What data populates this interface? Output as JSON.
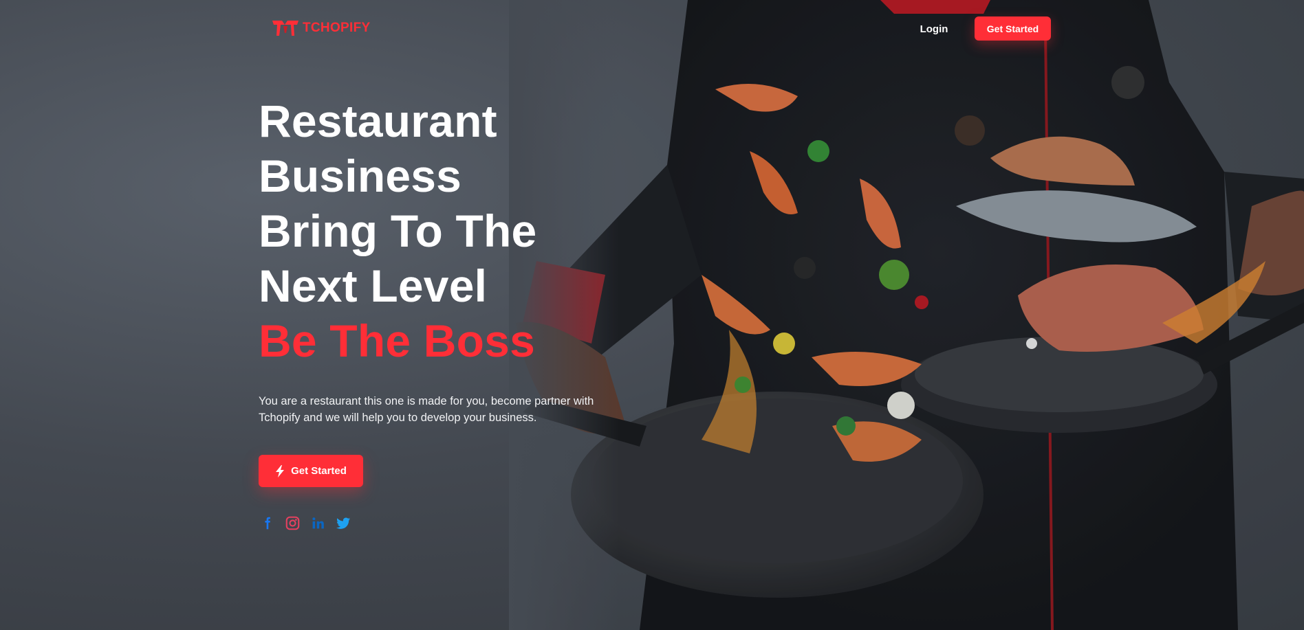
{
  "brand": {
    "name": "TCHOPIFY",
    "color": "#ff2e37"
  },
  "nav": {
    "login_label": "Login",
    "cta_label": "Get Started"
  },
  "hero": {
    "headline_lines": [
      "Restaurant",
      "Business",
      "Bring To The",
      "Next Level"
    ],
    "headline_accent": "Be The Boss",
    "description": "You are a restaurant this one is made for you, become partner with Tchopify and we will help you to develop your business.",
    "cta_label": "Get Started",
    "cta_icon": "lightning-bolt-icon",
    "background": "chef-tossing-seafood-in-pans"
  },
  "socials": [
    {
      "name": "facebook",
      "icon": "facebook-icon",
      "color": "#1877f2"
    },
    {
      "name": "instagram",
      "icon": "instagram-icon",
      "color": "#e4405f"
    },
    {
      "name": "linkedin",
      "icon": "linkedin-icon",
      "color": "#0a66c2"
    },
    {
      "name": "twitter",
      "icon": "twitter-icon",
      "color": "#1da1f2"
    }
  ],
  "colors": {
    "accent": "#ff2e37",
    "background": "#434850",
    "text": "#ffffff"
  }
}
